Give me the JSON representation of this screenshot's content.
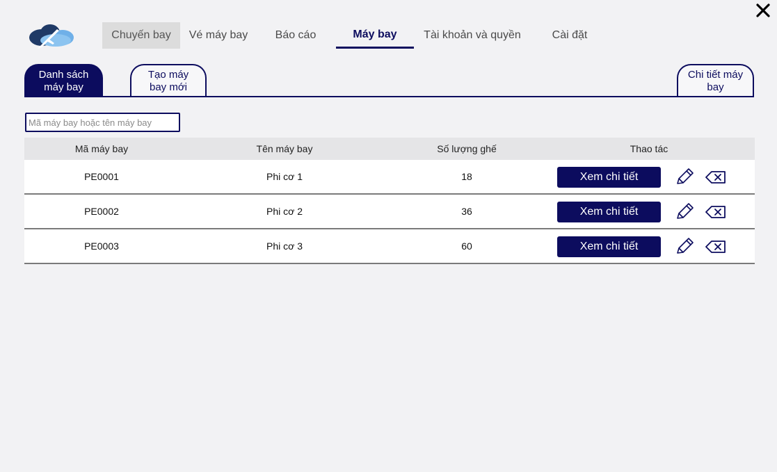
{
  "nav": {
    "tabs": [
      {
        "label": "Chuyến bay"
      },
      {
        "label": "Vé máy bay"
      },
      {
        "label": "Báo cáo"
      },
      {
        "label": "Máy bay"
      },
      {
        "label": "Tài khoản và quyền"
      },
      {
        "label": "Cài đặt"
      }
    ],
    "active_tab": "Máy bay",
    "hover_tab": "Chuyến bay"
  },
  "subtabs": {
    "list_label": "Danh sách máy bay",
    "create_label": "Tạo máy bay mới",
    "detail_label": "Chi tiết máy bay"
  },
  "search": {
    "placeholder": "Mã máy bay hoặc tên máy bay",
    "value": ""
  },
  "table": {
    "headers": [
      "Mã máy bay",
      "Tên máy bay",
      "Số lượng ghế",
      "Thao tác"
    ],
    "rows": [
      {
        "code": "PE0001",
        "name": "Phi cơ 1",
        "seats": "18"
      },
      {
        "code": "PE0002",
        "name": "Phi cơ 2",
        "seats": "36"
      },
      {
        "code": "PE0003",
        "name": "Phi cơ 3",
        "seats": "60"
      }
    ],
    "view_button_label": "Xem chi tiết"
  },
  "icons": {
    "close": "close-icon",
    "logo": "airplane-cloud-logo",
    "edit": "pencil-icon",
    "delete": "backspace-delete-icon"
  },
  "colors": {
    "primary": "#0c0c5e",
    "background": "#f2f2f4",
    "header_row": "#e5e5e7",
    "nav_hover": "#dcdcdc"
  }
}
